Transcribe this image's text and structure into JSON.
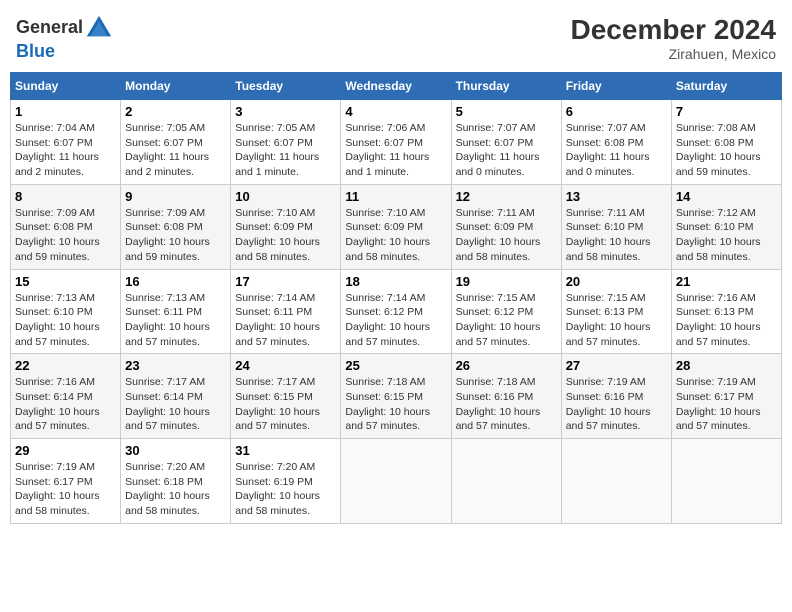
{
  "header": {
    "logo_line1": "General",
    "logo_line2": "Blue",
    "month": "December 2024",
    "location": "Zirahuen, Mexico"
  },
  "weekdays": [
    "Sunday",
    "Monday",
    "Tuesday",
    "Wednesday",
    "Thursday",
    "Friday",
    "Saturday"
  ],
  "weeks": [
    [
      {
        "day": "1",
        "sunrise": "Sunrise: 7:04 AM",
        "sunset": "Sunset: 6:07 PM",
        "daylight": "Daylight: 11 hours and 2 minutes."
      },
      {
        "day": "2",
        "sunrise": "Sunrise: 7:05 AM",
        "sunset": "Sunset: 6:07 PM",
        "daylight": "Daylight: 11 hours and 2 minutes."
      },
      {
        "day": "3",
        "sunrise": "Sunrise: 7:05 AM",
        "sunset": "Sunset: 6:07 PM",
        "daylight": "Daylight: 11 hours and 1 minute."
      },
      {
        "day": "4",
        "sunrise": "Sunrise: 7:06 AM",
        "sunset": "Sunset: 6:07 PM",
        "daylight": "Daylight: 11 hours and 1 minute."
      },
      {
        "day": "5",
        "sunrise": "Sunrise: 7:07 AM",
        "sunset": "Sunset: 6:07 PM",
        "daylight": "Daylight: 11 hours and 0 minutes."
      },
      {
        "day": "6",
        "sunrise": "Sunrise: 7:07 AM",
        "sunset": "Sunset: 6:08 PM",
        "daylight": "Daylight: 11 hours and 0 minutes."
      },
      {
        "day": "7",
        "sunrise": "Sunrise: 7:08 AM",
        "sunset": "Sunset: 6:08 PM",
        "daylight": "Daylight: 10 hours and 59 minutes."
      }
    ],
    [
      {
        "day": "8",
        "sunrise": "Sunrise: 7:09 AM",
        "sunset": "Sunset: 6:08 PM",
        "daylight": "Daylight: 10 hours and 59 minutes."
      },
      {
        "day": "9",
        "sunrise": "Sunrise: 7:09 AM",
        "sunset": "Sunset: 6:08 PM",
        "daylight": "Daylight: 10 hours and 59 minutes."
      },
      {
        "day": "10",
        "sunrise": "Sunrise: 7:10 AM",
        "sunset": "Sunset: 6:09 PM",
        "daylight": "Daylight: 10 hours and 58 minutes."
      },
      {
        "day": "11",
        "sunrise": "Sunrise: 7:10 AM",
        "sunset": "Sunset: 6:09 PM",
        "daylight": "Daylight: 10 hours and 58 minutes."
      },
      {
        "day": "12",
        "sunrise": "Sunrise: 7:11 AM",
        "sunset": "Sunset: 6:09 PM",
        "daylight": "Daylight: 10 hours and 58 minutes."
      },
      {
        "day": "13",
        "sunrise": "Sunrise: 7:11 AM",
        "sunset": "Sunset: 6:10 PM",
        "daylight": "Daylight: 10 hours and 58 minutes."
      },
      {
        "day": "14",
        "sunrise": "Sunrise: 7:12 AM",
        "sunset": "Sunset: 6:10 PM",
        "daylight": "Daylight: 10 hours and 58 minutes."
      }
    ],
    [
      {
        "day": "15",
        "sunrise": "Sunrise: 7:13 AM",
        "sunset": "Sunset: 6:10 PM",
        "daylight": "Daylight: 10 hours and 57 minutes."
      },
      {
        "day": "16",
        "sunrise": "Sunrise: 7:13 AM",
        "sunset": "Sunset: 6:11 PM",
        "daylight": "Daylight: 10 hours and 57 minutes."
      },
      {
        "day": "17",
        "sunrise": "Sunrise: 7:14 AM",
        "sunset": "Sunset: 6:11 PM",
        "daylight": "Daylight: 10 hours and 57 minutes."
      },
      {
        "day": "18",
        "sunrise": "Sunrise: 7:14 AM",
        "sunset": "Sunset: 6:12 PM",
        "daylight": "Daylight: 10 hours and 57 minutes."
      },
      {
        "day": "19",
        "sunrise": "Sunrise: 7:15 AM",
        "sunset": "Sunset: 6:12 PM",
        "daylight": "Daylight: 10 hours and 57 minutes."
      },
      {
        "day": "20",
        "sunrise": "Sunrise: 7:15 AM",
        "sunset": "Sunset: 6:13 PM",
        "daylight": "Daylight: 10 hours and 57 minutes."
      },
      {
        "day": "21",
        "sunrise": "Sunrise: 7:16 AM",
        "sunset": "Sunset: 6:13 PM",
        "daylight": "Daylight: 10 hours and 57 minutes."
      }
    ],
    [
      {
        "day": "22",
        "sunrise": "Sunrise: 7:16 AM",
        "sunset": "Sunset: 6:14 PM",
        "daylight": "Daylight: 10 hours and 57 minutes."
      },
      {
        "day": "23",
        "sunrise": "Sunrise: 7:17 AM",
        "sunset": "Sunset: 6:14 PM",
        "daylight": "Daylight: 10 hours and 57 minutes."
      },
      {
        "day": "24",
        "sunrise": "Sunrise: 7:17 AM",
        "sunset": "Sunset: 6:15 PM",
        "daylight": "Daylight: 10 hours and 57 minutes."
      },
      {
        "day": "25",
        "sunrise": "Sunrise: 7:18 AM",
        "sunset": "Sunset: 6:15 PM",
        "daylight": "Daylight: 10 hours and 57 minutes."
      },
      {
        "day": "26",
        "sunrise": "Sunrise: 7:18 AM",
        "sunset": "Sunset: 6:16 PM",
        "daylight": "Daylight: 10 hours and 57 minutes."
      },
      {
        "day": "27",
        "sunrise": "Sunrise: 7:19 AM",
        "sunset": "Sunset: 6:16 PM",
        "daylight": "Daylight: 10 hours and 57 minutes."
      },
      {
        "day": "28",
        "sunrise": "Sunrise: 7:19 AM",
        "sunset": "Sunset: 6:17 PM",
        "daylight": "Daylight: 10 hours and 57 minutes."
      }
    ],
    [
      {
        "day": "29",
        "sunrise": "Sunrise: 7:19 AM",
        "sunset": "Sunset: 6:17 PM",
        "daylight": "Daylight: 10 hours and 58 minutes."
      },
      {
        "day": "30",
        "sunrise": "Sunrise: 7:20 AM",
        "sunset": "Sunset: 6:18 PM",
        "daylight": "Daylight: 10 hours and 58 minutes."
      },
      {
        "day": "31",
        "sunrise": "Sunrise: 7:20 AM",
        "sunset": "Sunset: 6:19 PM",
        "daylight": "Daylight: 10 hours and 58 minutes."
      },
      null,
      null,
      null,
      null
    ]
  ]
}
